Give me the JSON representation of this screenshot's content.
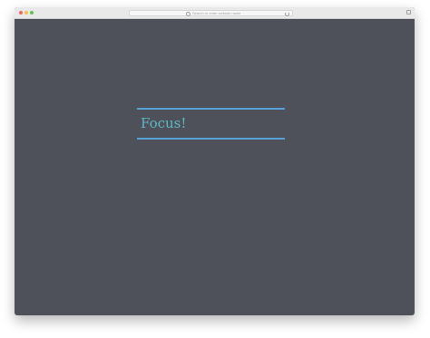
{
  "browser": {
    "address_placeholder": "Search or enter website name"
  },
  "page": {
    "focus_text": "Focus!"
  },
  "colors": {
    "page_background": "#4e5159",
    "accent_line": "#54a2d6",
    "focus_text": "#5fb8c6"
  }
}
